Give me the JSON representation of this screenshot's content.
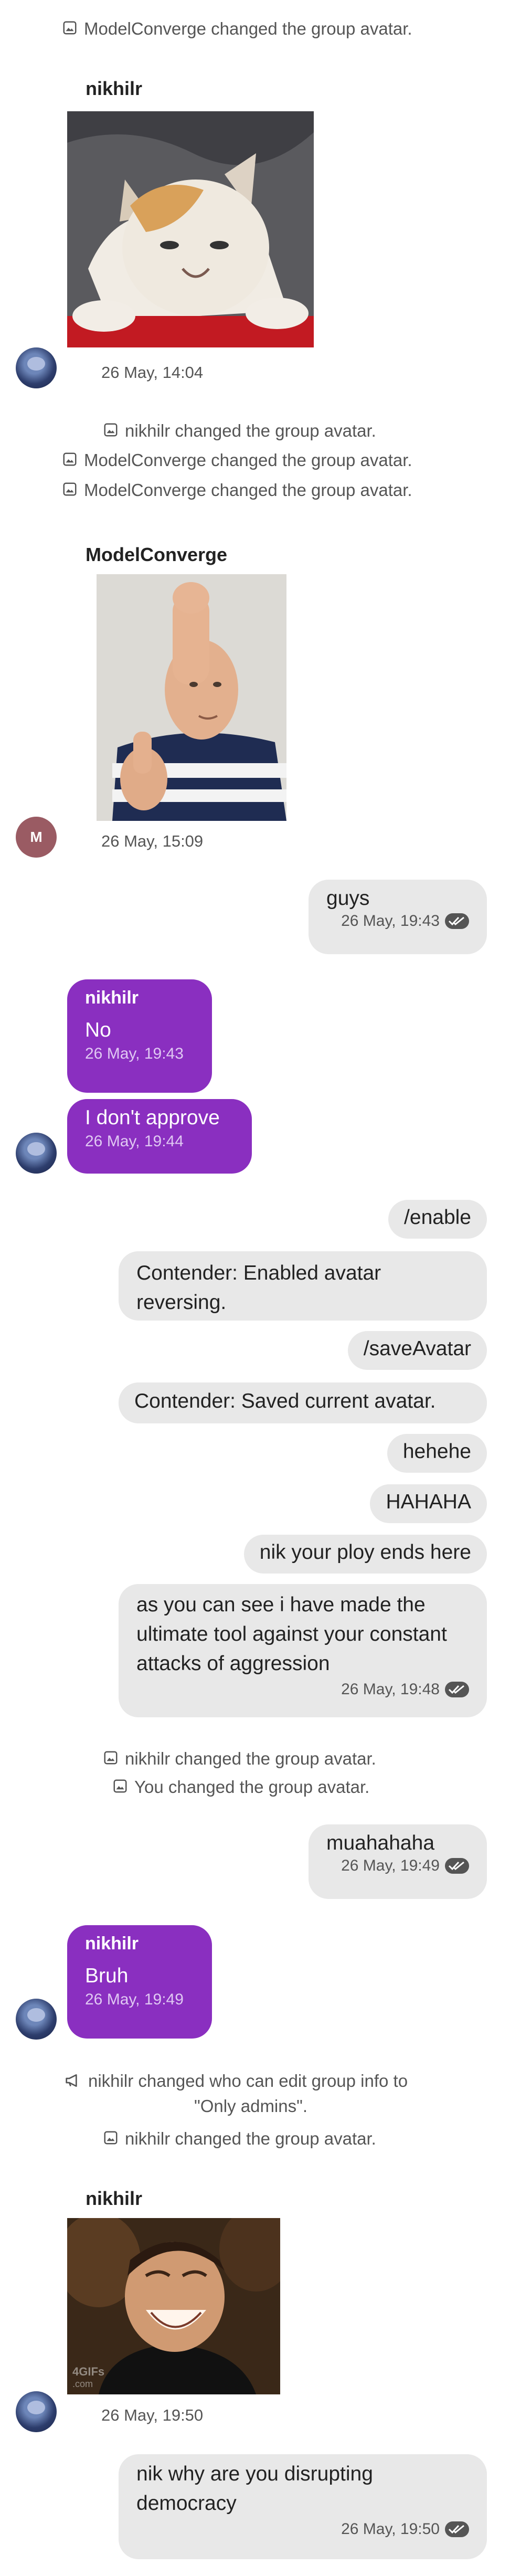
{
  "feed": {
    "sys1": "ModelConverge changed the group avatar.",
    "msg1": {
      "sender": "nikhilr",
      "time": "26 May, 14:04"
    },
    "sys2": "nikhilr changed the group avatar.",
    "sys3": "ModelConverge changed the group avatar.",
    "sys4": "ModelConverge changed the group avatar.",
    "msg2": {
      "sender": "ModelConverge",
      "time": "26 May, 15:09",
      "avatar_initial": "M"
    },
    "out1": {
      "text": "guys",
      "time": "26 May, 19:43"
    },
    "in1": {
      "sender": "nikhilr",
      "text": "No",
      "time": "26 May, 19:43"
    },
    "in2": {
      "text": "I don't approve",
      "time": "26 May, 19:44"
    },
    "out2": {
      "text": "/enable"
    },
    "out3": {
      "text": "Contender: Enabled avatar reversing."
    },
    "out4": {
      "text": "/saveAvatar"
    },
    "out5": {
      "text": "Contender: Saved current avatar."
    },
    "out6": {
      "text": "hehehe"
    },
    "out7": {
      "text": "HAHAHA"
    },
    "out8": {
      "text": "nik your ploy ends here"
    },
    "out9": {
      "text": "as you can see i have made the ultimate tool against your constant attacks of aggression",
      "time": "26 May, 19:48"
    },
    "sys5": "nikhilr changed the group avatar.",
    "sys6": "You changed the group avatar.",
    "out10": {
      "text": "muahahaha",
      "time": "26 May, 19:49"
    },
    "in3": {
      "sender": "nikhilr",
      "text": "Bruh",
      "time": "26 May, 19:49"
    },
    "sys7_line1": "nikhilr changed who can edit group info to",
    "sys7_line2": "\"Only admins\".",
    "sys8": "nikhilr changed the group avatar.",
    "msg3": {
      "sender": "nikhilr",
      "time": "26 May, 19:50",
      "gif_watermark_1": "4GIFs",
      "gif_watermark_2": ".com"
    },
    "out11": {
      "text": "nik why are you disrupting democracy",
      "time": "26 May, 19:50"
    }
  },
  "colors": {
    "incoming_bubble": "#8a2fc0",
    "outgoing_bubble": "#e8e8e8",
    "system_text": "#555555"
  },
  "icons": {
    "avatar_change": "image-icon",
    "settings_change": "megaphone-icon",
    "read_receipt": "double-check-icon"
  }
}
